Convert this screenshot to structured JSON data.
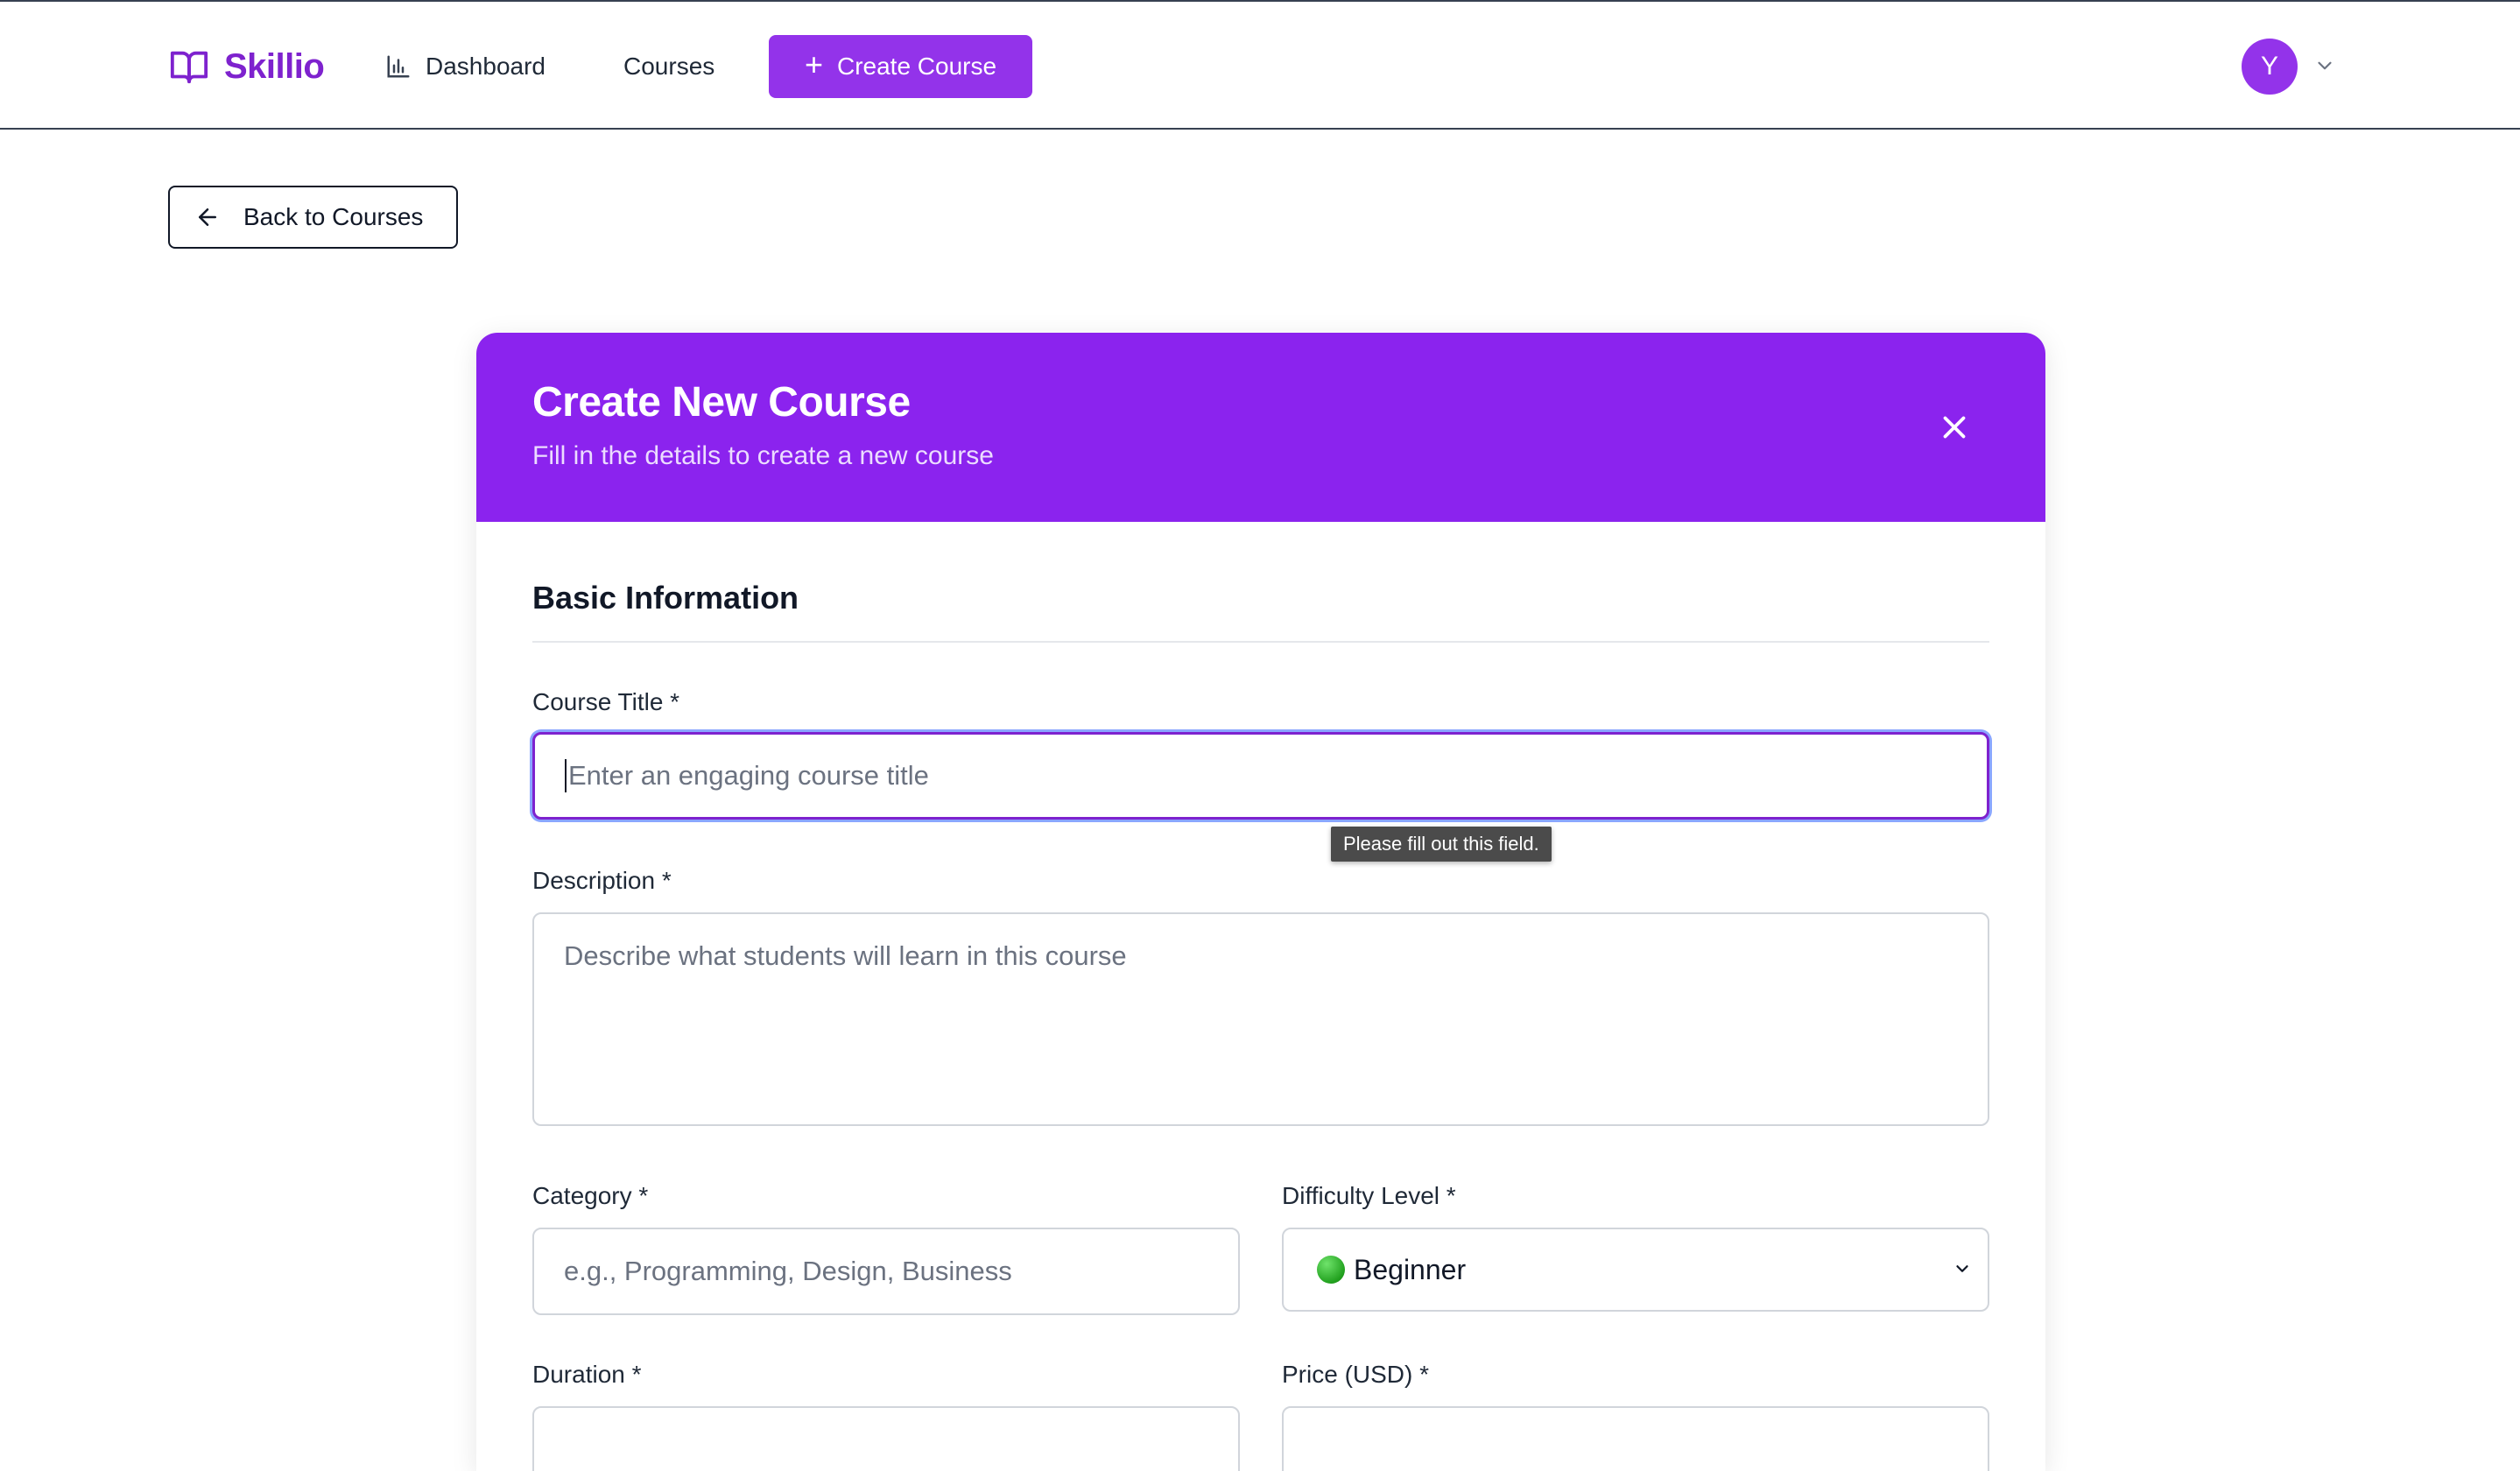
{
  "app": {
    "brand": "Skillio",
    "brand_color": "#7e22ce",
    "accent_color": "#9333ea",
    "nav": {
      "dashboard_label": "Dashboard",
      "courses_label": "Courses",
      "create_label": "Create Course"
    },
    "user": {
      "avatar_initial": "Y"
    }
  },
  "back": {
    "label": "Back to Courses"
  },
  "form": {
    "title": "Create New Course",
    "subtitle": "Fill in the details to create a new course",
    "section_basic": "Basic Information",
    "course_title": {
      "label": "Course Title *",
      "placeholder": "Enter an engaging course title",
      "value": "",
      "validation_tooltip": "Please fill out this field."
    },
    "description": {
      "label": "Description *",
      "placeholder": "Describe what students will learn in this course",
      "value": ""
    },
    "category": {
      "label": "Category *",
      "placeholder": "e.g., Programming, Design, Business",
      "value": ""
    },
    "difficulty": {
      "label": "Difficulty Level *",
      "selected": "Beginner",
      "icon": "green-circle-icon"
    },
    "duration": {
      "label": "Duration *"
    },
    "price": {
      "label": "Price (USD) *"
    }
  }
}
